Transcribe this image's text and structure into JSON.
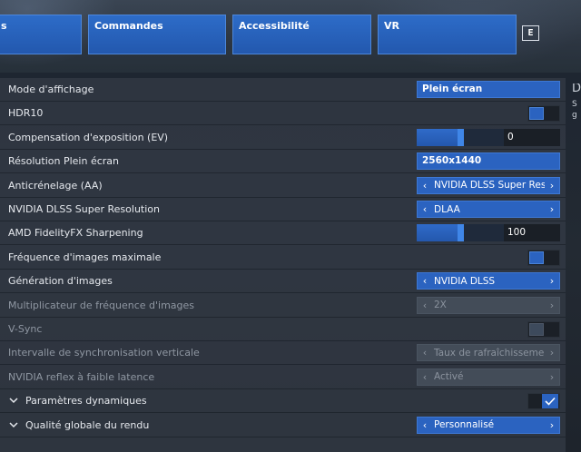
{
  "tabs": [
    {
      "label": "s"
    },
    {
      "label": "Commandes"
    },
    {
      "label": "Accessibilité"
    },
    {
      "label": "VR"
    }
  ],
  "hotkey": "E",
  "colors": {
    "accent": "#2b63c0",
    "panel": "#343c46"
  },
  "settings": [
    {
      "label": "Mode d'affichage",
      "control": "button",
      "value": "Plein écran"
    },
    {
      "label": "HDR10",
      "control": "toggle",
      "on": false
    },
    {
      "label": "Compensation d'exposition (EV)",
      "control": "slider",
      "value": "0",
      "level": 0.5
    },
    {
      "label": "Résolution Plein écran",
      "control": "button",
      "value": "2560x1440"
    },
    {
      "label": "Anticrénelage (AA)",
      "control": "selector",
      "value": "NVIDIA DLSS Super Resolution"
    },
    {
      "label": "NVIDIA DLSS Super Resolution",
      "control": "selector",
      "value": "DLAA"
    },
    {
      "label": "AMD FidelityFX Sharpening",
      "control": "slider",
      "value": "100",
      "level": 0.5
    },
    {
      "label": "Fréquence d'images maximale",
      "control": "toggle",
      "on": false
    },
    {
      "label": "Génération d'images",
      "control": "selector",
      "value": "NVIDIA DLSS"
    },
    {
      "label": "Multiplicateur de fréquence d'images",
      "control": "selector",
      "value": "2X",
      "disabled": true
    },
    {
      "label": "V-Sync",
      "control": "toggle",
      "on": false,
      "disabled": true
    },
    {
      "label": "Intervalle de synchronisation verticale",
      "control": "selector",
      "value": "Taux de rafraîchissement",
      "disabled": true
    },
    {
      "label": "NVIDIA reflex à faible latence",
      "control": "selector",
      "value": "Activé",
      "disabled": true
    },
    {
      "label": "Paramètres dynamiques",
      "control": "checkbox",
      "on": true,
      "expandable": true
    },
    {
      "label": "Qualité globale du rendu",
      "control": "selector",
      "value": "Personnalisé",
      "expandable": true
    }
  ],
  "side_info": {
    "title": "D",
    "line1": "S",
    "line2": "g"
  }
}
